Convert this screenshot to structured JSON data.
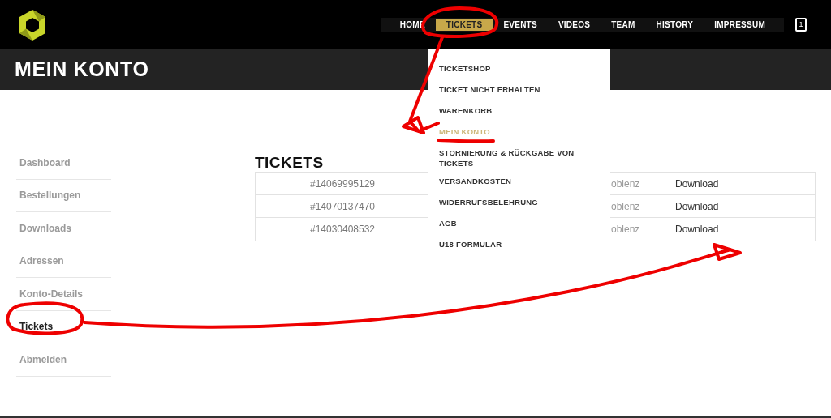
{
  "nav": {
    "items": [
      {
        "label": "HOME",
        "selected": false
      },
      {
        "label": "TICKETS",
        "selected": true
      },
      {
        "label": "EVENTS",
        "selected": false
      },
      {
        "label": "VIDEOS",
        "selected": false
      },
      {
        "label": "TEAM",
        "selected": false
      },
      {
        "label": "HISTORY",
        "selected": false
      },
      {
        "label": "IMPRESSUM",
        "selected": false
      }
    ],
    "cart_count": "1"
  },
  "page_title": "MEIN KONTO",
  "dropdown": {
    "items": [
      {
        "label": "TICKETSHOP",
        "selected": false
      },
      {
        "label": "TICKET NICHT ERHALTEN",
        "selected": false
      },
      {
        "label": "WARENKORB",
        "selected": false
      },
      {
        "label": "MEIN KONTO",
        "selected": true
      },
      {
        "label": "STORNIERUNG & RÜCKGABE VON TICKETS",
        "selected": false
      },
      {
        "label": "VERSANDKOSTEN",
        "selected": false
      },
      {
        "label": "WIDERRUFSBELEHRUNG",
        "selected": false
      },
      {
        "label": "AGB",
        "selected": false
      },
      {
        "label": "U18 FORMULAR",
        "selected": false
      }
    ]
  },
  "sidebar": {
    "items": [
      {
        "label": "Dashboard",
        "selected": false
      },
      {
        "label": "Bestellungen",
        "selected": false
      },
      {
        "label": "Downloads",
        "selected": false
      },
      {
        "label": "Adressen",
        "selected": false
      },
      {
        "label": "Konto-Details",
        "selected": false
      },
      {
        "label": "Tickets",
        "selected": true
      },
      {
        "label": "Abmelden",
        "selected": false
      }
    ]
  },
  "section_title": "TICKETS",
  "tickets": {
    "rows": [
      {
        "number": "#14069995129",
        "column_2": "oblenz",
        "action": "Download"
      },
      {
        "number": "#14070137470",
        "column_2": "oblenz",
        "action": "Download"
      },
      {
        "number": "#14030408532",
        "column_2": "oblenz",
        "action": "Download"
      }
    ]
  }
}
